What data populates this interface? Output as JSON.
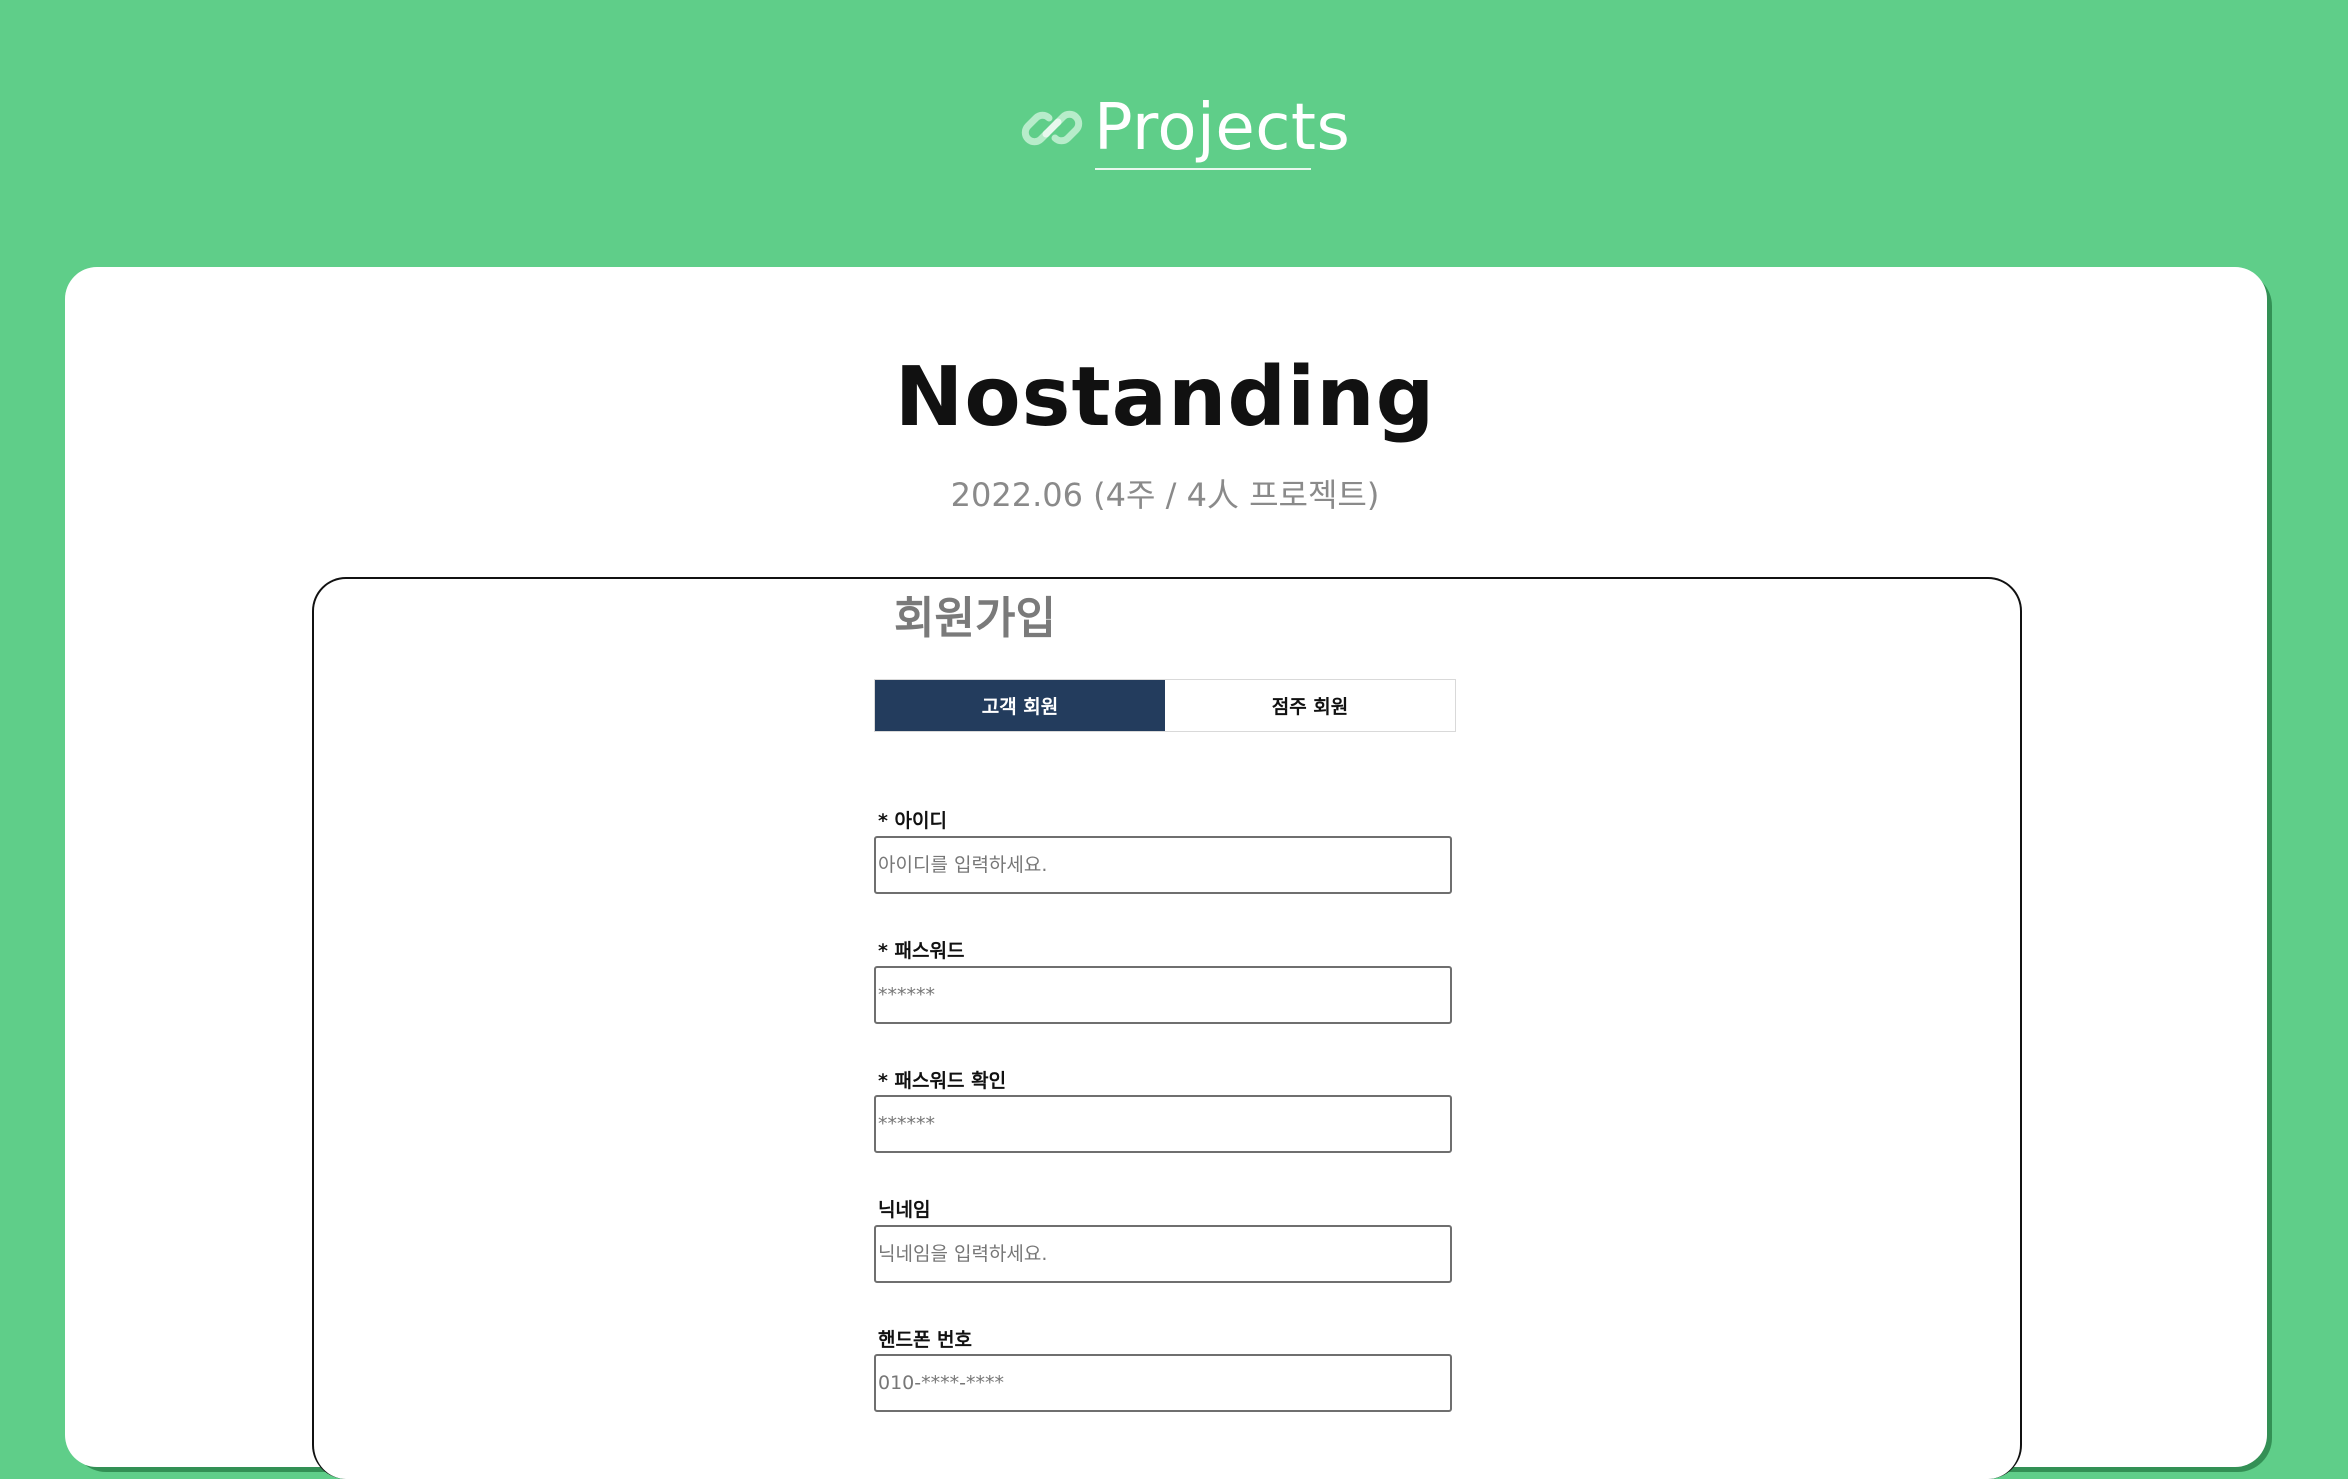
{
  "header": {
    "icon": "link-icon",
    "title": "Projects"
  },
  "project": {
    "name": "Nostanding",
    "meta": "2022.06 (4주 / 4人 프로젝트)"
  },
  "signup": {
    "title": "회원가입",
    "tabs": [
      {
        "label": "고객 회원",
        "active": true
      },
      {
        "label": "점주 회원",
        "active": false
      }
    ],
    "fields": [
      {
        "label": "* 아이디",
        "placeholder": "아이디를 입력하세요."
      },
      {
        "label": "* 패스워드",
        "placeholder": "******"
      },
      {
        "label": "* 패스워드 확인",
        "placeholder": "******"
      },
      {
        "label": "닉네임",
        "placeholder": "닉네임을 입력하세요."
      },
      {
        "label": "핸드폰 번호",
        "placeholder": "010-****-****"
      }
    ]
  },
  "colors": {
    "background": "#5fce89",
    "active_tab": "#233c5d"
  }
}
